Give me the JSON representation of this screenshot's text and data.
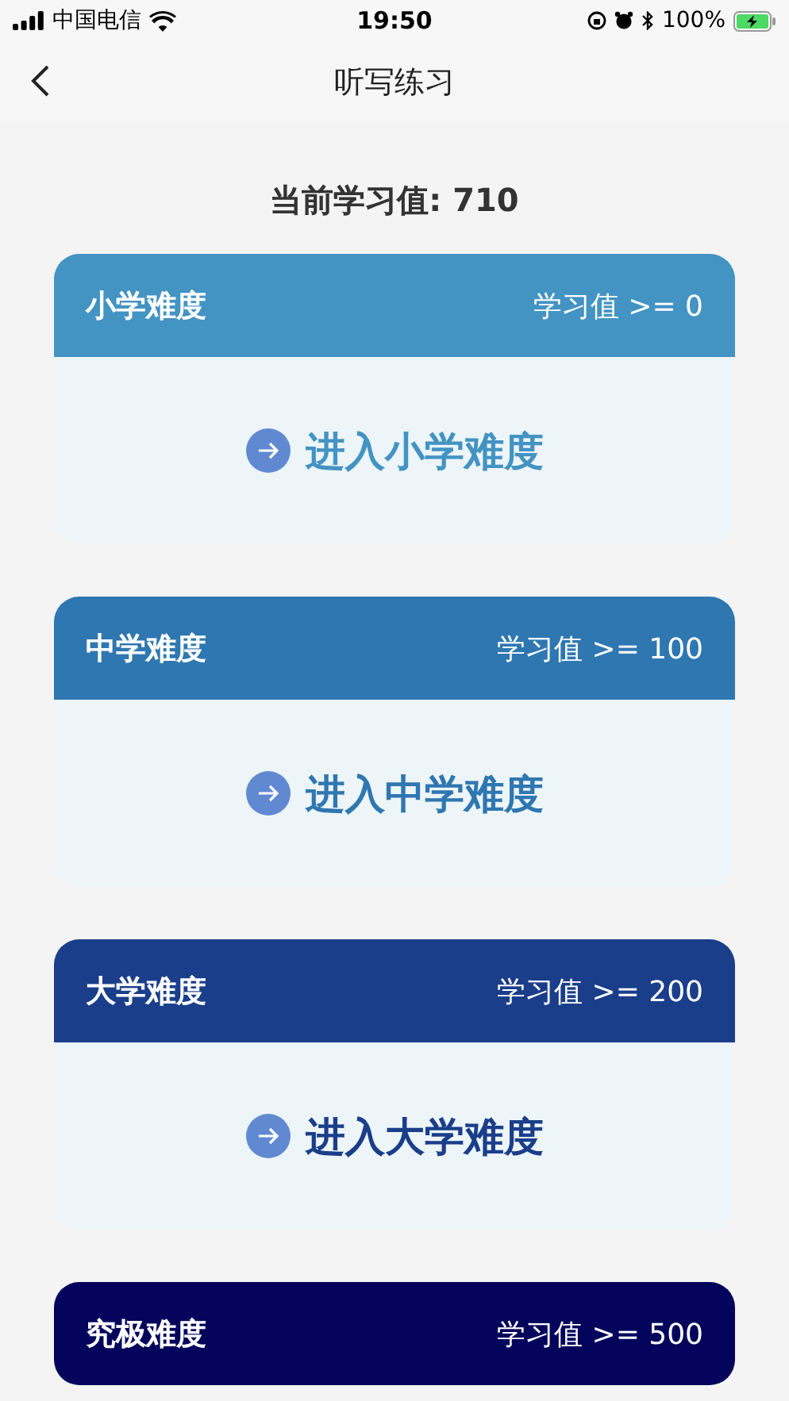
{
  "status_bar": {
    "carrier": "中国电信",
    "time": "19:50",
    "battery": "100%"
  },
  "nav": {
    "title": "听写练习"
  },
  "score": "当前学习值: 710",
  "levels": [
    {
      "name": "小学难度",
      "requirement": "学习值 >= 0",
      "color": "#4393c3",
      "enter_label": "进入小学难度"
    },
    {
      "name": "中学难度",
      "requirement": "学习值 >= 100",
      "color": "#2f77b1",
      "enter_label": "进入中学难度"
    },
    {
      "name": "大学难度",
      "requirement": "学习值 >= 200",
      "color": "#1a3e8a",
      "enter_label": "进入大学难度"
    },
    {
      "name": "究极难度",
      "requirement": "学习值 >= 500",
      "color": "#04045c"
    }
  ]
}
